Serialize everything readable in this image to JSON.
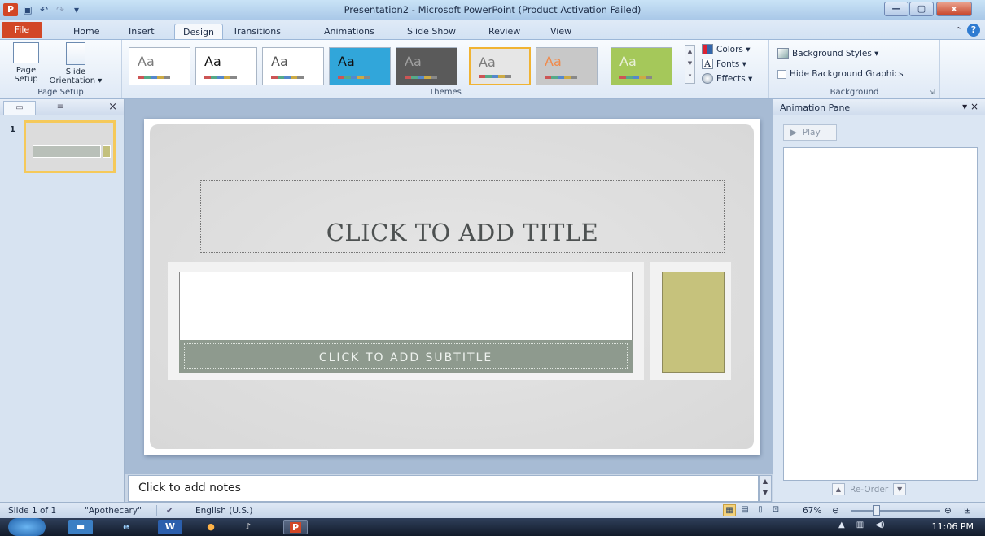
{
  "window": {
    "title": "Presentation2 - Microsoft PowerPoint (Product Activation Failed)",
    "app_icon": "P",
    "minimize": "—",
    "maximize": "▢",
    "close": "x"
  },
  "tabs": [
    "File",
    "Home",
    "Insert",
    "Design",
    "Transitions",
    "Animations",
    "Slide Show",
    "Review",
    "View"
  ],
  "active_tab": "Design",
  "ribbon": {
    "page_setup": {
      "page_setup_label": "Page Setup",
      "page_setup_btn_line1": "Page",
      "page_setup_btn_line2": "Setup",
      "slide_orientation_line1": "Slide",
      "slide_orientation_line2": "Orientation ▾",
      "group_label": "Page Setup"
    },
    "themes": {
      "group_label": "Themes",
      "items": [
        {
          "label": "Aa",
          "bg": "#ffffff",
          "fg": "#7b7b7b"
        },
        {
          "label": "Aa",
          "bg": "#ffffff",
          "fg": "#111111"
        },
        {
          "label": "Aa",
          "bg": "#ffffff",
          "fg": "#555555"
        },
        {
          "label": "Aa",
          "bg": "#31a6da",
          "fg": "#111111"
        },
        {
          "label": "Aa",
          "bg": "#5a5a5a",
          "fg": "#a0a0a0"
        },
        {
          "label": "Aa",
          "bg": "#e6e6e6",
          "fg": "#7b7b7b"
        },
        {
          "label": "Aa",
          "bg": "#c8c8c8",
          "fg": "#f08a4b"
        },
        {
          "label": "Aa",
          "bg": "#a5c85a",
          "fg": "#e9f0d8"
        }
      ],
      "colors_label": "Colors ▾",
      "fonts_label": "Fonts ▾",
      "effects_label": "Effects ▾"
    },
    "background": {
      "background_styles_label": "Background Styles ▾",
      "hide_bg_graphics_label": "Hide Background Graphics",
      "group_label": "Background"
    }
  },
  "thumbnails": {
    "slide_number": "1"
  },
  "slide": {
    "title_placeholder": "CLICK TO ADD TITLE",
    "subtitle_placeholder": "CLICK TO ADD SUBTITLE",
    "accent_color": "#c6c27c",
    "band_color": "#8e9a8e"
  },
  "notes": {
    "placeholder": "Click to add notes"
  },
  "animation_pane": {
    "title": "Animation Pane",
    "play_label": "Play",
    "reorder_label": "Re-Order"
  },
  "statusbar": {
    "slide_info": "Slide 1 of 1",
    "theme_name": "\"Apothecary\"",
    "language": "English (U.S.)",
    "zoom": "67%"
  },
  "taskbar": {
    "time": "11:06 PM"
  }
}
